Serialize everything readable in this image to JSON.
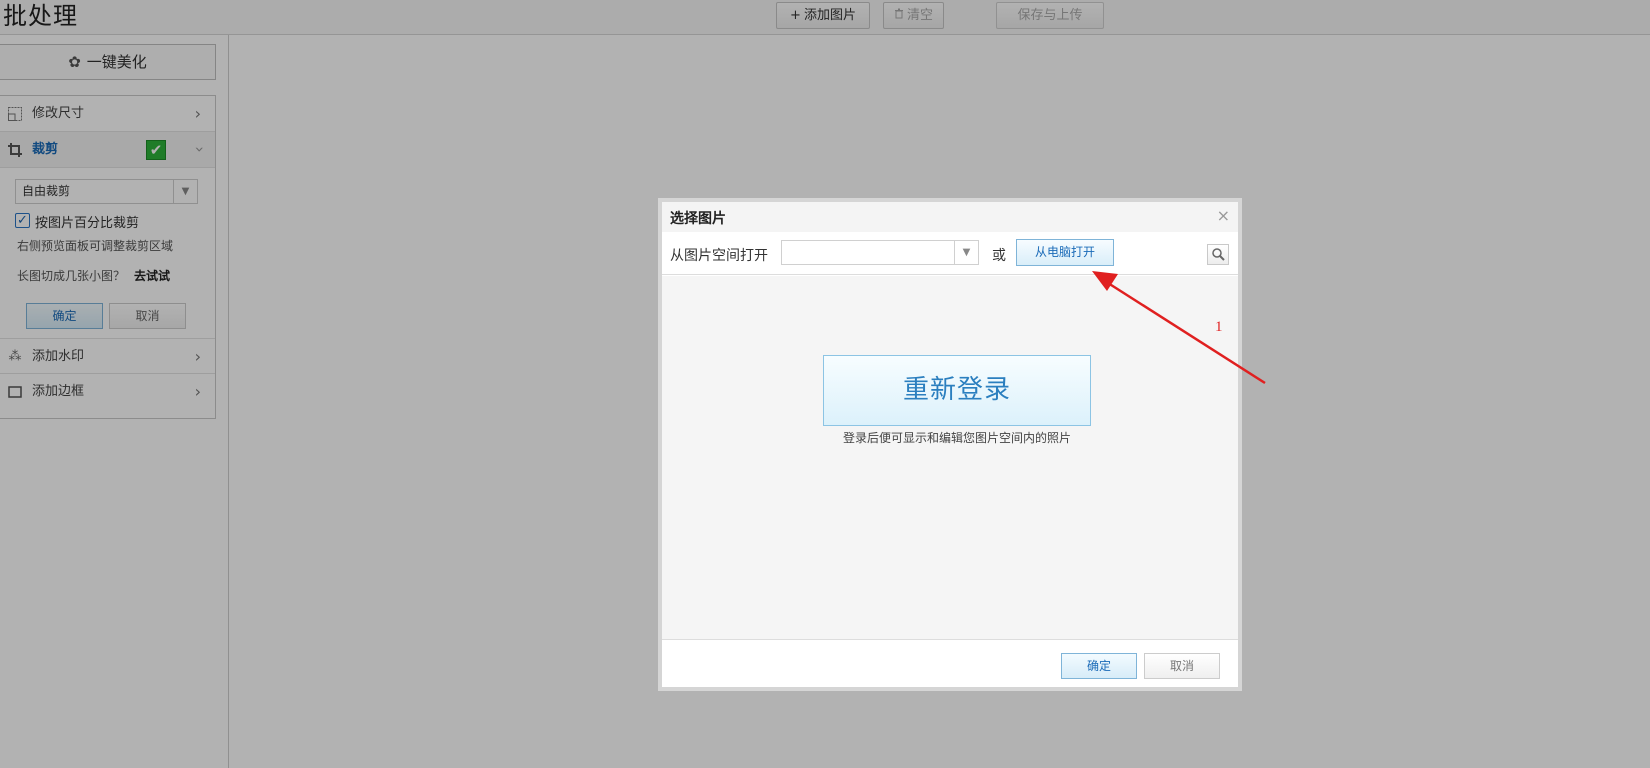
{
  "app": {
    "title": "批处理"
  },
  "toolbar": {
    "add_image_label": "添加图片",
    "clear_label": "清空",
    "save_upload_label": "保存与上传",
    "add_icon": "plus-icon",
    "clear_icon": "trash-icon"
  },
  "sidebar": {
    "beautify_label": "一键美化",
    "items": [
      {
        "label": "修改尺寸",
        "icon": "resize-icon",
        "expanded": false
      },
      {
        "label": "裁剪",
        "icon": "crop-icon",
        "expanded": true,
        "enabled": true
      },
      {
        "label": "添加水印",
        "icon": "watermark-icon",
        "expanded": false
      },
      {
        "label": "添加边框",
        "icon": "frame-icon",
        "expanded": false
      }
    ],
    "crop": {
      "mode_value": "自由裁剪",
      "by_percent_label": "按图片百分比裁剪",
      "by_percent_checked": true,
      "hint": "右侧预览面板可调整裁剪区域",
      "long_image_question": "长图切成几张小图？",
      "try_link": "去试试",
      "ok_label": "确定",
      "cancel_label": "取消"
    }
  },
  "dialog": {
    "title": "选择图片",
    "close_glyph": "×",
    "open_from_space_label": "从图片空间打开",
    "space_select_value": "",
    "or_text": "或",
    "open_from_pc_label": "从电脑打开",
    "relogin_label": "重新登录",
    "relogin_hint": "登录后便可显示和编辑您图片空间内的照片",
    "ok_label": "确定",
    "cancel_label": "取消"
  },
  "annotation": {
    "number": "1",
    "color": "#e02020"
  },
  "colors": {
    "accent": "#1b6bb8",
    "check_green": "#2db23a"
  }
}
